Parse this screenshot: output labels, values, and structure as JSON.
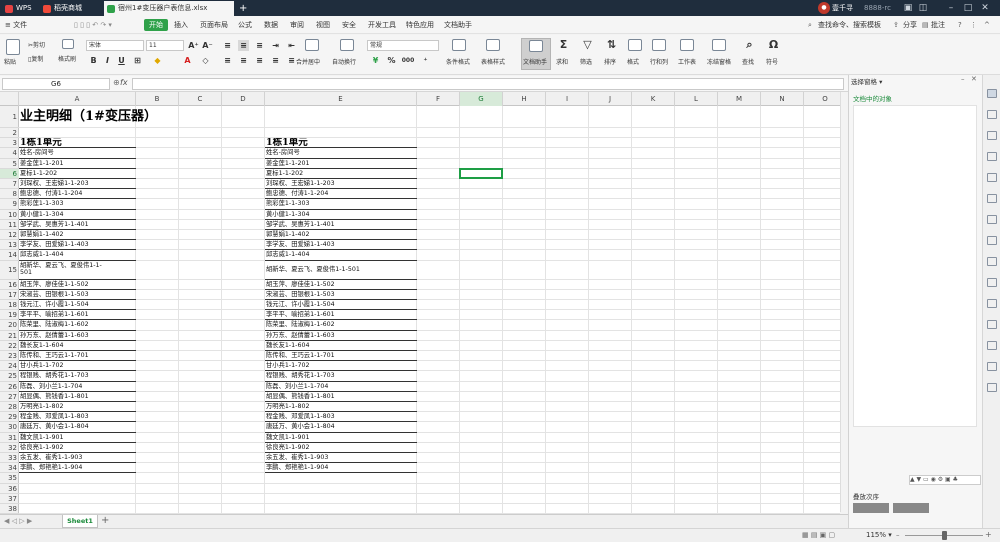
{
  "tabs": {
    "wps": "WPS",
    "store": "稻壳商城",
    "file": "宿州1#变压器户表信息.xlsx",
    "add": "+"
  },
  "titlebar": {
    "user": "壹千寻",
    "id": "8888-rc"
  },
  "menu": {
    "file": "≡ 文件",
    "start": "开始",
    "insert": "插入",
    "layout": "页面布局",
    "formula": "公式",
    "data": "数据",
    "review": "审阅",
    "view": "视图",
    "security": "安全",
    "dev": "开发工具",
    "special": "特色应用",
    "doc": "文档助手",
    "search": "查找命令、搜索模板",
    "share": "分享",
    "comment": "批注"
  },
  "ribbon": {
    "paste": "粘贴",
    "cut": "剪切",
    "copy": "复制",
    "brush": "格式刷",
    "font": "宋体",
    "size": "11",
    "merge": "合并居中",
    "wrap": "自动换行",
    "numfmt": "常规",
    "percent": "%",
    "thousands": "000",
    "cond": "条件格式",
    "tablestyle": "表格样式",
    "dochelper": "文档助手",
    "sum": "求和",
    "filter": "筛选",
    "sort": "排序",
    "format": "格式",
    "rowcol": "行和列",
    "sheet": "工作表",
    "freeze": "冻结窗格",
    "find": "查找",
    "symbol": "符号"
  },
  "formula": {
    "name": "G6",
    "fx": "fx"
  },
  "columns": [
    "A",
    "B",
    "C",
    "D",
    "E",
    "F",
    "G",
    "H",
    "I",
    "J",
    "K",
    "L",
    "M",
    "N",
    "O"
  ],
  "rows": [
    "1",
    "2",
    "3",
    "4",
    "5",
    "6",
    "7",
    "8",
    "9",
    "10",
    "11",
    "12",
    "13",
    "14",
    "15",
    "16",
    "17",
    "18",
    "19",
    "20",
    "21",
    "22",
    "23",
    "24",
    "25",
    "26",
    "27",
    "28",
    "29",
    "30",
    "31",
    "32",
    "33",
    "34",
    "35",
    "36",
    "37",
    "38"
  ],
  "sheet": {
    "title": "业主明细（1#变压器）",
    "unit": "1栋1单元",
    "header": "姓名-房间号",
    "list": [
      "姜金莲1-1-201",
      "夏标1-1-202",
      "刘琛权、王宏娣1-1-203",
      "鲍忠德、付涛1-1-204",
      "熊彩莲1-1-303",
      "黄小健1-1-304",
      "邹学武、吴惠芳1-1-401",
      "郭慧娟1-1-402",
      "李学友、田爱娣1-1-403",
      "邱志威1-1-404",
      "胡新华、夏云飞、夏俊伟1-1-501",
      "胡玉萍、廖佳佳1-1-502",
      "宋淑芸、田银根1-1-503",
      "钱元江、许小霞1-1-504",
      "李平平、喻招弟1-1-601",
      "陈荣里、陆淑梅1-1-602",
      "孙万东、赵倩蕾1-1-603",
      "魏长友1-1-604",
      "陈传和、王巧云1-1-701",
      "甘小兵1-1-702",
      "程银贱、胡秀花1-1-703",
      "陈磊、刘小兰1-1-704",
      "胡显偶、熊钱香1-1-801",
      "万明亮1-1-802",
      "程金贱、邓爱凤1-1-803",
      "唐廷万、黄小会1-1-804",
      "魏文凯1-1-901",
      "徐良亮1-1-902",
      "余五发、崔秀1-1-903",
      "李鹏、郑艳艳1-1-904"
    ],
    "list_A15": "胡新华、夏云飞、夏俊伟1-1-\n501"
  },
  "sheettab": "Sheet1",
  "panel": {
    "title": "选择窗格 ▾",
    "objects": "文档中的对象",
    "order": "叠放次序"
  },
  "status": {
    "zoom": "115% ▾"
  },
  "accent": "#2fa14a"
}
